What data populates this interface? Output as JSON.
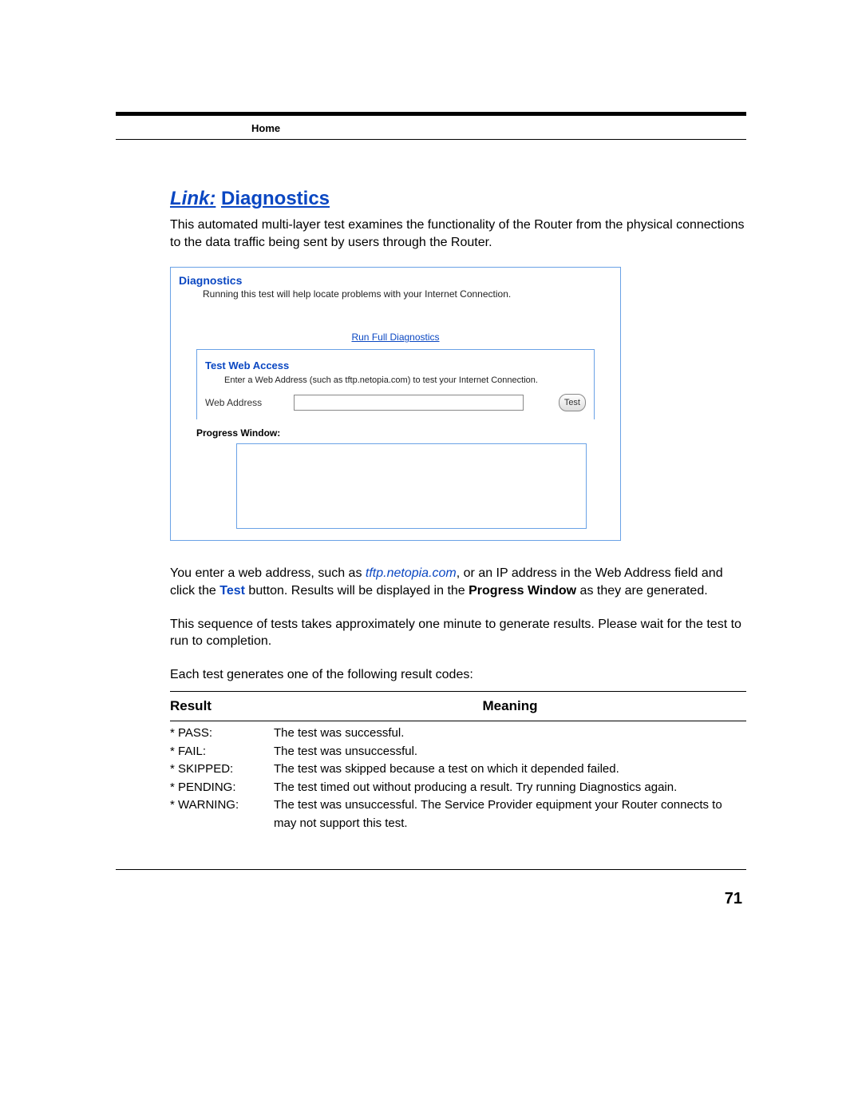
{
  "header": {
    "section": "Home"
  },
  "title": {
    "prefix": "Link:",
    "main": "Diagnostics"
  },
  "intro": "This automated multi-layer test examines the functionality of the Router from the physical connections to the data traffic being sent by users through the Router.",
  "panel": {
    "title": "Diagnostics",
    "subtitle": "Running this test will help locate problems with your Internet Connection.",
    "run_link": "Run Full Diagnostics",
    "test_section_title": "Test Web Access",
    "test_section_desc": "Enter a Web Address (such as tftp.netopia.com) to test your Internet Connection.",
    "web_address_label": "Web Address",
    "web_address_value": "",
    "test_button": "Test",
    "progress_label": "Progress Window:"
  },
  "mid": {
    "p1_a": "You enter a web address, such as ",
    "p1_addr": "tftp.netopia.com",
    "p1_b": ", or an IP address in the Web Address field and click the ",
    "p1_test": "Test",
    "p1_c": " button. Results will be displayed in the ",
    "p1_pw": "Progress Window",
    "p1_d": " as they are generated.",
    "p2": "This sequence of tests takes approximately one minute to generate results. Please wait for the test to run to completion.",
    "p3": "Each test generates one of the following result codes:"
  },
  "table": {
    "head_result": "Result",
    "head_meaning": "Meaning",
    "rows": [
      {
        "result": "* PASS:",
        "meaning": "The test was successful."
      },
      {
        "result": "* FAIL:",
        "meaning": "The test was unsuccessful."
      },
      {
        "result": "* SKIPPED:",
        "meaning": "The test was skipped because a test on which it depended failed."
      },
      {
        "result": "* PENDING:",
        "meaning": "The test timed out without producing a result. Try running Diagnostics again."
      },
      {
        "result": "* WARNING:",
        "meaning": "The test was unsuccessful. The Service Provider equipment your Router connects to may not support this test."
      }
    ]
  },
  "page_number": "71"
}
